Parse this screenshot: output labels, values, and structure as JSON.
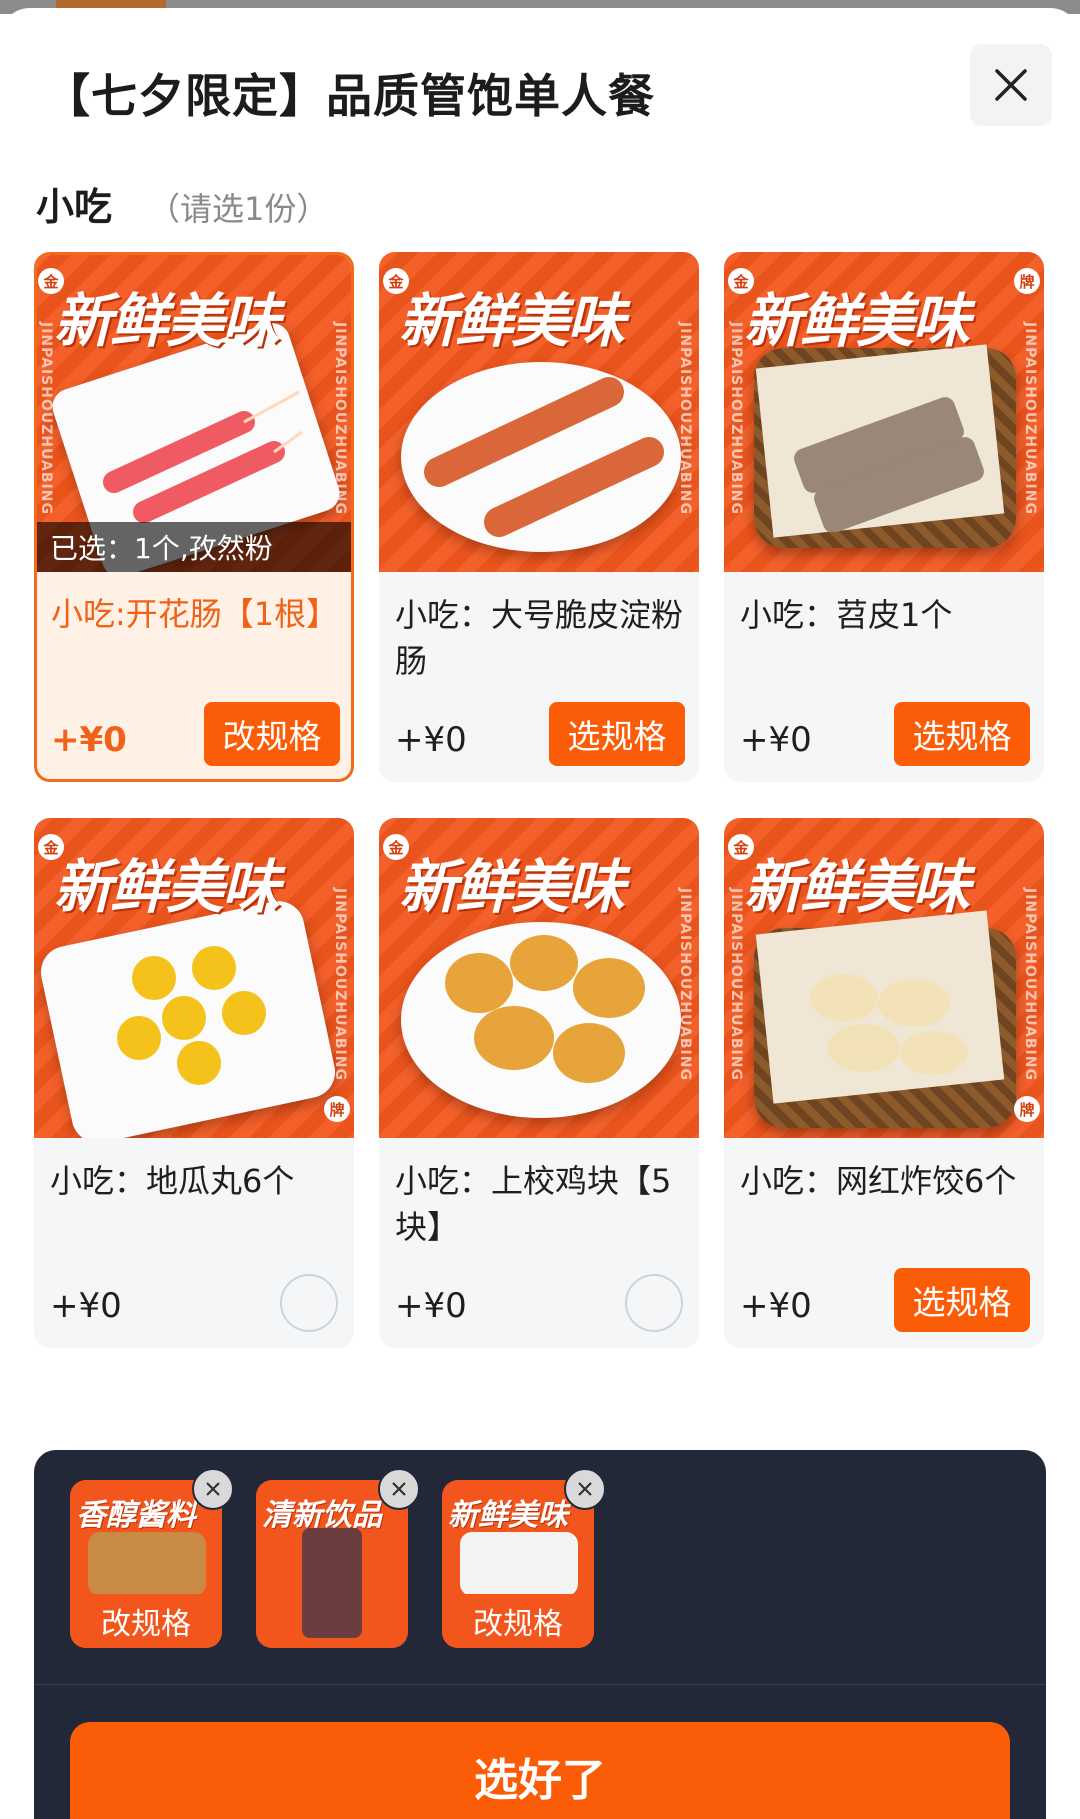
{
  "header": {
    "title": "【七夕限定】品质管饱单人餐"
  },
  "section": {
    "title": "小吃",
    "hint": "（请选1份）"
  },
  "image_banner": "新鲜美味",
  "image_side_text": "JINPAISHOUZHUABING",
  "image_badges": [
    "金",
    "牌"
  ],
  "items": [
    {
      "name": "小吃:开花肠【1根】",
      "price": "+¥0",
      "action": "改规格",
      "selected": true,
      "selected_text": "已选：1个,孜然粉"
    },
    {
      "name": "小吃：大号脆皮淀粉肠",
      "price": "+¥0",
      "action": "选规格",
      "selected": false
    },
    {
      "name": "小吃：苕皮1个",
      "price": "+¥0",
      "action": "选规格",
      "selected": false
    },
    {
      "name": "小吃：地瓜丸6个",
      "price": "+¥0",
      "action": "",
      "selected": false
    },
    {
      "name": "小吃：上校鸡块【5块】",
      "price": "+¥0",
      "action": "",
      "selected": false
    },
    {
      "name": "小吃：网红炸饺6个",
      "price": "+¥0",
      "action": "选规格",
      "selected": false
    }
  ],
  "tray": {
    "items": [
      {
        "banner": "香醇酱料",
        "label": "改规格"
      },
      {
        "banner": "清新饮品",
        "label": ""
      },
      {
        "banner": "新鲜美味",
        "label": "改规格"
      }
    ],
    "confirm_label": "选好了"
  },
  "colors": {
    "accent": "#fb5c07",
    "selected_bg": "#fff1e6",
    "tray_bg": "#232839",
    "card_bg": "#f4f6f8"
  },
  "icons": {
    "close": "close-icon",
    "remove": "remove-icon"
  }
}
